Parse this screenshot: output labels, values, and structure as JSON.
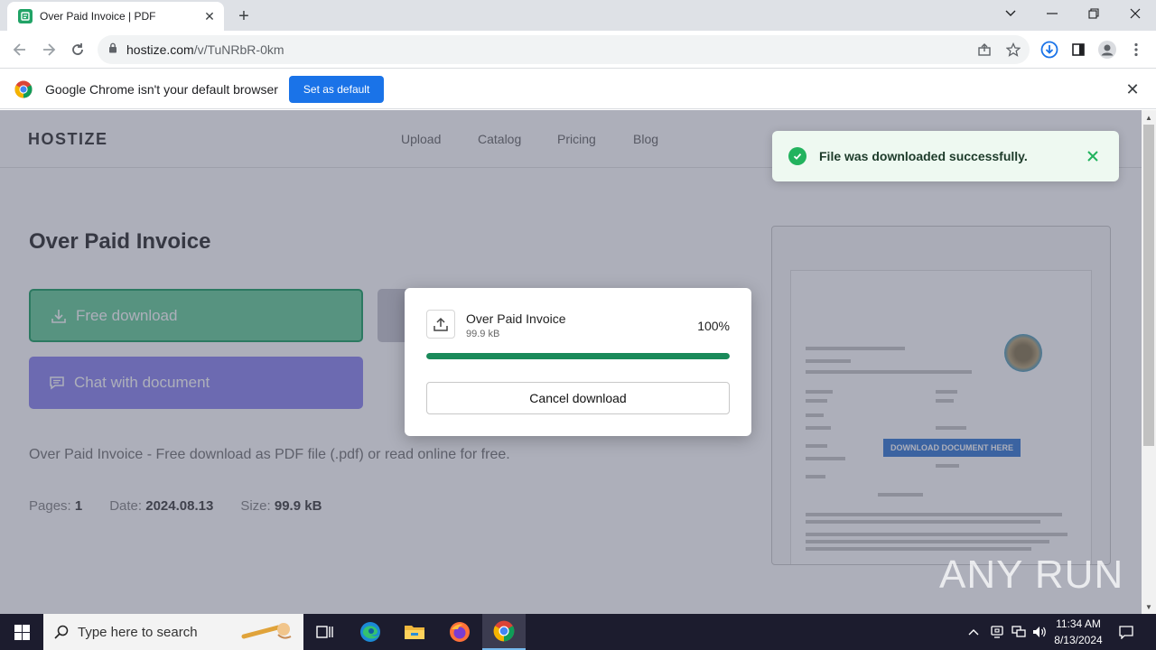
{
  "browser": {
    "tab_title": "Over Paid Invoice | PDF",
    "url_host": "hostize.com",
    "url_path": "/v/TuNRbR-0km"
  },
  "infobar": {
    "message": "Google Chrome isn't your default browser",
    "button_label": "Set as default"
  },
  "site": {
    "logo": "HOSTIZE",
    "nav": [
      "Upload",
      "Catalog",
      "Pricing",
      "Blog"
    ]
  },
  "document": {
    "title": "Over Paid Invoice",
    "free_download_label": "Free download",
    "chat_label": "Chat with document",
    "description": "Over Paid Invoice - Free download as PDF file (.pdf) or read online for free.",
    "pages_label": "Pages:",
    "pages_value": "1",
    "date_label": "Date:",
    "date_value": "2024.08.13",
    "size_label": "Size:",
    "size_value": "99.9 kB",
    "preview_badge": "DOWNLOAD DOCUMENT HERE"
  },
  "download_modal": {
    "file_name": "Over Paid Invoice",
    "file_size": "99.9 kB",
    "percent_text": "100%",
    "progress_fraction": 1.0,
    "cancel_label": "Cancel download"
  },
  "toast": {
    "message": "File was downloaded successfully."
  },
  "watermark": "ANY RUN",
  "taskbar": {
    "search_placeholder": "Type here to search",
    "time": "11:34 AM",
    "date": "8/13/2024"
  },
  "colors": {
    "chrome_frame": "#dee1e6",
    "chrome_blue": "#1a73e8",
    "download_green": "#21a366",
    "chat_purple": "#8f89f0",
    "progress_green": "#1a8a5a",
    "toast_green": "#22b35e"
  }
}
